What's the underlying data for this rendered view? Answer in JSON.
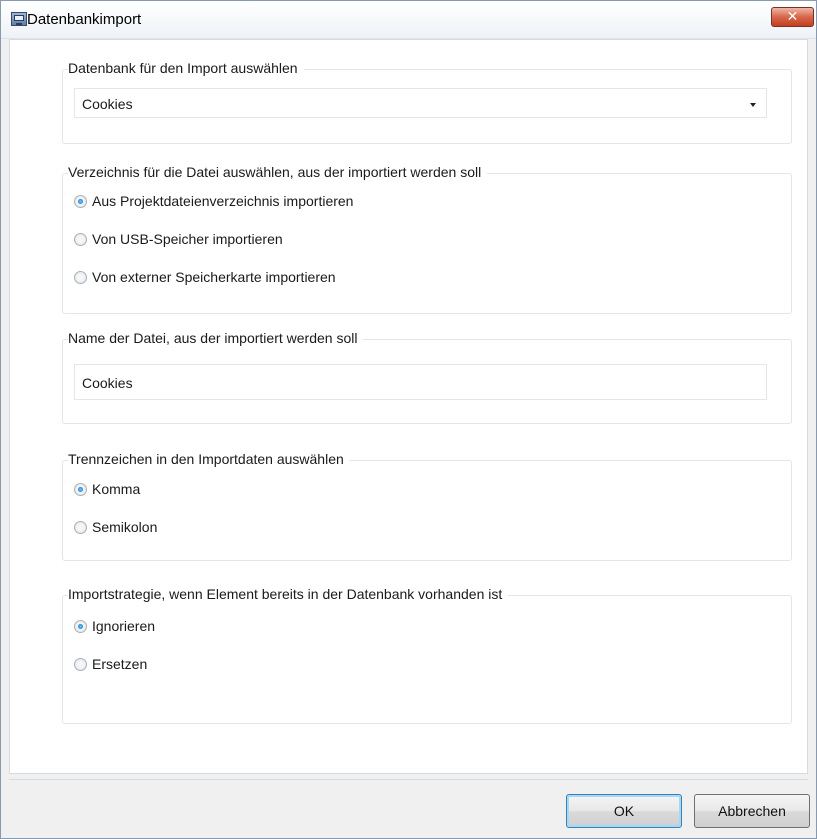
{
  "window": {
    "title": "Datenbankimport",
    "close_label": "✕"
  },
  "database_group": {
    "label": "Datenbank für den Import auswählen",
    "selected": "Cookies"
  },
  "directory_group": {
    "label": "Verzeichnis für die Datei auswählen, aus der importiert werden soll",
    "options": [
      {
        "label": "Aus Projektdateienverzeichnis importieren",
        "checked": true
      },
      {
        "label": "Von USB-Speicher importieren",
        "checked": false
      },
      {
        "label": "Von externer Speicherkarte importieren",
        "checked": false
      }
    ]
  },
  "filename_group": {
    "label": "Name der Datei, aus der importiert werden soll",
    "value": "Cookies"
  },
  "separator_group": {
    "label": "Trennzeichen in den Importdaten auswählen",
    "options": [
      {
        "label": "Komma",
        "checked": true
      },
      {
        "label": "Semikolon",
        "checked": false
      }
    ]
  },
  "strategy_group": {
    "label": "Importstrategie, wenn Element bereits in der Datenbank vorhanden ist",
    "options": [
      {
        "label": "Ignorieren",
        "checked": true
      },
      {
        "label": "Ersetzen",
        "checked": false
      }
    ]
  },
  "buttons": {
    "ok": "OK",
    "cancel": "Abbrechen"
  }
}
